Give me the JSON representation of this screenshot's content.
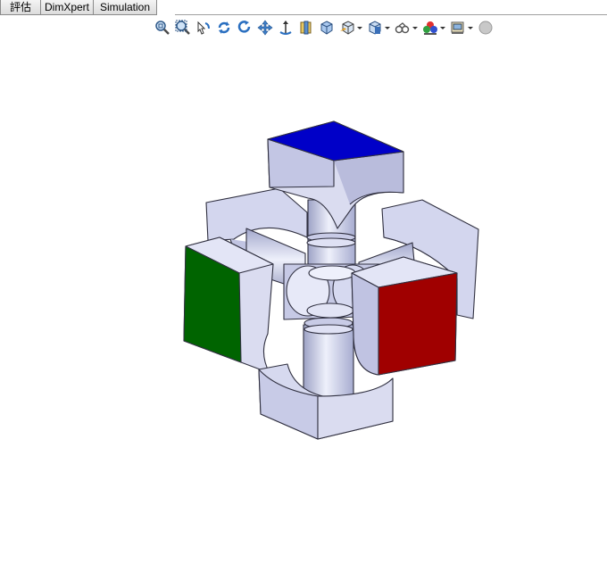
{
  "tabs": [
    {
      "label": "評估"
    },
    {
      "label": "DimXpert"
    },
    {
      "label": "Simulation"
    }
  ],
  "toolbar": {
    "icons": [
      "zoom-to-fit-icon",
      "zoom-to-area-icon",
      "previous-view-icon",
      "rebuild-icon",
      "rotate-view-icon",
      "pan-icon",
      "roll-view-icon",
      "section-view-icon",
      "view-orientation-icon",
      "display-style-icon",
      "hide-show-items-icon",
      "edit-appearance-icon",
      "apply-scene-icon",
      "view-settings-icon",
      "realview-sphere-icon"
    ]
  },
  "model": {
    "face_colors": {
      "top": "#0000c8",
      "left": "#006400",
      "right": "#a00000",
      "body": "#dadcf0",
      "body_shade": "#b4b8d8",
      "edge": "#303040"
    }
  }
}
